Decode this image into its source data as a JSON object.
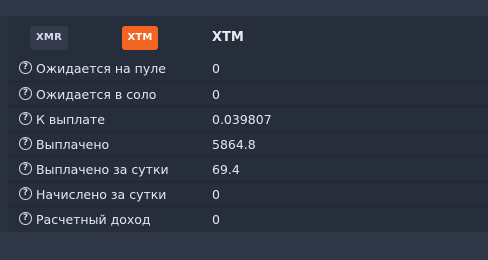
{
  "coin_tabs": [
    {
      "label": "XMR",
      "active": false
    },
    {
      "label": "XTM",
      "active": true
    }
  ],
  "selected_coin": "XTM",
  "colors": {
    "accent": "#f26522",
    "panel": "#262d3b",
    "background": "#2b3241"
  },
  "stats": [
    {
      "label": "Ожидается на пуле",
      "value": "0",
      "icon": "question-circle-icon"
    },
    {
      "label": "Ожидается в соло",
      "value": "0",
      "icon": "question-circle-icon"
    },
    {
      "label": "К выплате",
      "value": "0.039807",
      "icon": "question-circle-icon"
    },
    {
      "label": "Выплачено",
      "value": "5864.8",
      "icon": "question-circle-icon"
    },
    {
      "label": "Выплачено за сутки",
      "value": "69.4",
      "icon": "question-circle-icon"
    },
    {
      "label": "Начислено за сутки",
      "value": "0",
      "icon": "question-circle-icon"
    },
    {
      "label": "Расчетный доход",
      "value": "0",
      "icon": "question-circle-icon"
    }
  ]
}
